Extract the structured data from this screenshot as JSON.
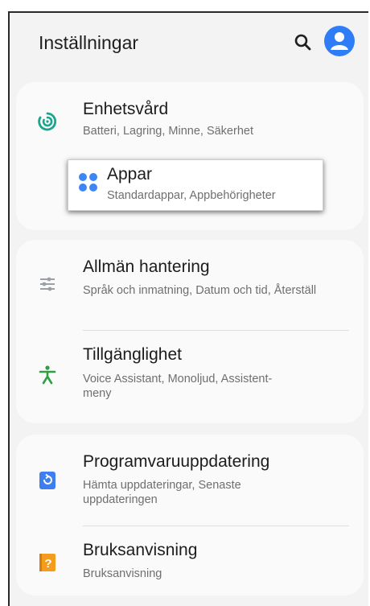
{
  "header": {
    "title": "Inställningar"
  },
  "icons": {
    "search": "search-icon",
    "account": "account-icon"
  },
  "colors": {
    "accent_blue": "#2f7df6",
    "device_care_teal": "#1aa58f",
    "accessibility_green": "#2f9e44",
    "update_blue": "#3d7ef0",
    "manual_orange": "#f39c1e",
    "general_gray": "#9aa0a6"
  },
  "sections": [
    {
      "items": [
        {
          "label": "Enhetsvård",
          "sub": "Batteri, Lagring, Minne, Säkerhet",
          "icon": "device-care-icon"
        },
        {
          "label": "Appar",
          "sub": "Standardappar, Appbehörigheter",
          "icon": "apps-icon",
          "highlighted": true
        }
      ]
    },
    {
      "items": [
        {
          "label": "Allmän hantering",
          "sub": "Språk och inmatning, Datum och tid, Återställ",
          "icon": "sliders-icon"
        },
        {
          "label": "Tillgänglighet",
          "sub": "Voice Assistant, Monoljud, Assistent-meny",
          "icon": "accessibility-icon"
        }
      ]
    },
    {
      "items": [
        {
          "label": "Programvaruuppdatering",
          "sub": "Hämta uppdateringar, Senaste uppdateringen",
          "icon": "software-update-icon"
        },
        {
          "label": "Bruksanvisning",
          "sub": "Bruksanvisning",
          "icon": "user-manual-icon"
        }
      ]
    }
  ]
}
